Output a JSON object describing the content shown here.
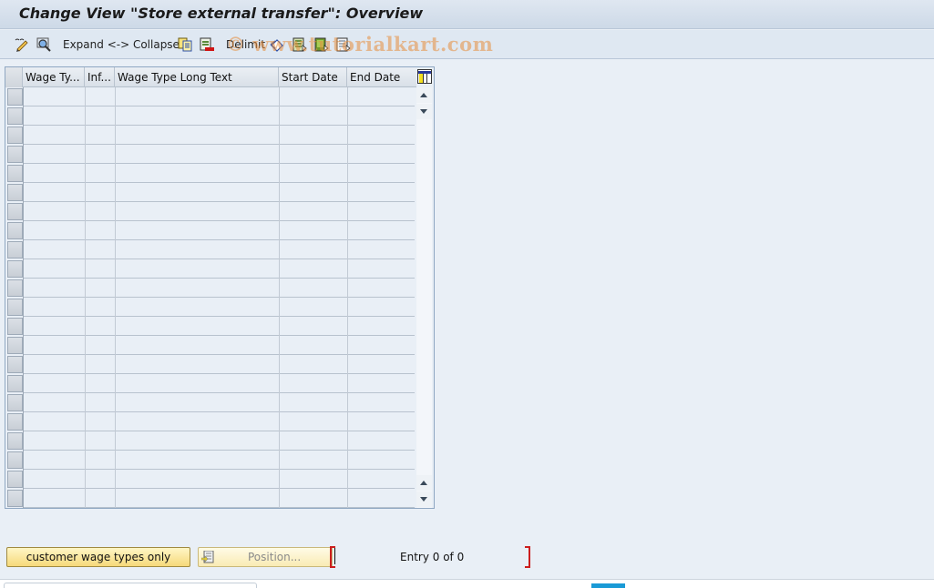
{
  "title": "Change View \"Store external transfer\": Overview",
  "toolbar": {
    "expand_collapse_label": "Expand <-> Collapse",
    "delimit_label": "Delimit",
    "icons": [
      "change-display-icon",
      "find-icon",
      "expand-collapse-button",
      "copy-icon",
      "delete-icon",
      "delimit-button",
      "undo-change-icon",
      "select-all-icon",
      "select-block-icon",
      "deselect-all-icon"
    ]
  },
  "watermark": "© www.tutorialkart.com",
  "table": {
    "columns": [
      "Wage Ty...",
      "Inf...",
      "Wage Type Long Text",
      "Start Date",
      "End Date"
    ],
    "row_count": 22,
    "rows": []
  },
  "footer": {
    "customer_button_label": "customer wage types only",
    "position_button_label": "Position...",
    "entry_text": "Entry 0 of 0"
  },
  "colors": {
    "background": "#e9eff6",
    "button_yellow": "#f6d97a",
    "bracket_red": "#cc1e1e"
  }
}
